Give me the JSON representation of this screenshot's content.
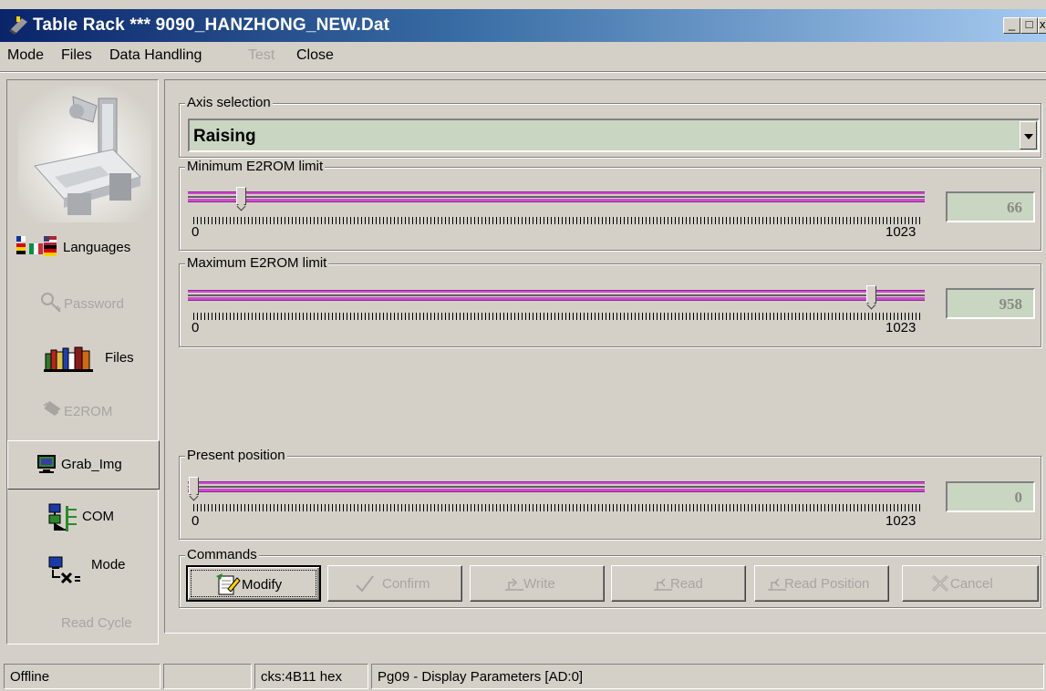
{
  "window": {
    "title": "Table Rack *** 9090_HANZHONG_NEW.Dat",
    "min_label": "_",
    "max_label": "□",
    "close_label": "x"
  },
  "menu": {
    "items": [
      {
        "label": "Mode",
        "enabled": true
      },
      {
        "label": "Files",
        "enabled": true
      },
      {
        "label": "Data Handling",
        "enabled": true
      },
      {
        "label": "Test",
        "enabled": false
      },
      {
        "label": "Close",
        "enabled": true
      }
    ]
  },
  "sidebar": {
    "items": [
      {
        "label": "Languages",
        "icon": "flags-icon",
        "enabled": true
      },
      {
        "label": "Password",
        "icon": "key-icon",
        "enabled": false
      },
      {
        "label": "Files",
        "icon": "books-icon",
        "enabled": true
      },
      {
        "label": "E2ROM",
        "icon": "chip-icon",
        "enabled": false
      },
      {
        "label": "Grab_Img",
        "icon": "monitor-icon",
        "enabled": true
      },
      {
        "label": "COM",
        "icon": "network-icon",
        "enabled": true
      },
      {
        "label": "Mode",
        "icon": "computer-mode-icon",
        "enabled": true
      },
      {
        "label": "Read Cycle",
        "icon": "",
        "enabled": false
      }
    ]
  },
  "axis": {
    "group_title": "Axis selection",
    "selected": "Raising"
  },
  "min_limit": {
    "group_title": "Minimum E2ROM limit",
    "min": "0",
    "max": "1023",
    "value": "66"
  },
  "max_limit": {
    "group_title": "Maximum E2ROM limit",
    "min": "0",
    "max": "1023",
    "value": "958"
  },
  "present": {
    "group_title": "Present position",
    "min": "0",
    "max": "1023",
    "value": "0"
  },
  "commands": {
    "group_title": "Commands",
    "buttons": [
      {
        "label": "Modify",
        "icon": "modify-icon",
        "enabled": true
      },
      {
        "label": "Confirm",
        "icon": "checkmark-icon",
        "enabled": false
      },
      {
        "label": "Write",
        "icon": "write-icon",
        "enabled": false
      },
      {
        "label": "Read",
        "icon": "read-icon",
        "enabled": false
      },
      {
        "label": "Read Position",
        "icon": "read-position-icon",
        "enabled": false
      },
      {
        "label": "Cancel",
        "icon": "cancel-icon",
        "enabled": false
      }
    ]
  },
  "status": {
    "connection": "Offline",
    "blank": "",
    "checksum": "cks:4B11 hex",
    "page": "Pg09 - Display Parameters [AD:0]"
  },
  "colors": {
    "titlebar_start": "#0a246a",
    "titlebar_end": "#a6caf0",
    "slider_track": "#d14ad0",
    "field_bg": "#c9d6c2",
    "face": "#d4d0c8"
  }
}
